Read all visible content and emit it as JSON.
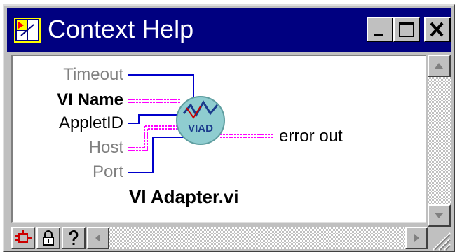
{
  "window": {
    "title": "Context Help",
    "accent_color": "#000080"
  },
  "diagram": {
    "inputs": [
      {
        "label": "Timeout",
        "style": "gray",
        "wire": "blue"
      },
      {
        "label": "VI Name",
        "style": "bold",
        "wire": "pink"
      },
      {
        "label": "AppletID",
        "style": "normal",
        "wire": "blue"
      },
      {
        "label": "Host",
        "style": "gray",
        "wire": "pink"
      },
      {
        "label": "Port",
        "style": "gray",
        "wire": "blue"
      }
    ],
    "outputs": [
      {
        "label": "error out",
        "wire": "pink"
      }
    ],
    "node_icon_text": "VIAD",
    "vi_name": "VI Adapter.vi",
    "colors": {
      "wire_blue": "#0000cc",
      "wire_pink": "#ff00ff",
      "node_fill": "#8fcdd0",
      "gray_text": "#808080"
    }
  },
  "toolbar": {
    "buttons": [
      "diagram-icon",
      "lock-icon",
      "help-icon"
    ]
  }
}
